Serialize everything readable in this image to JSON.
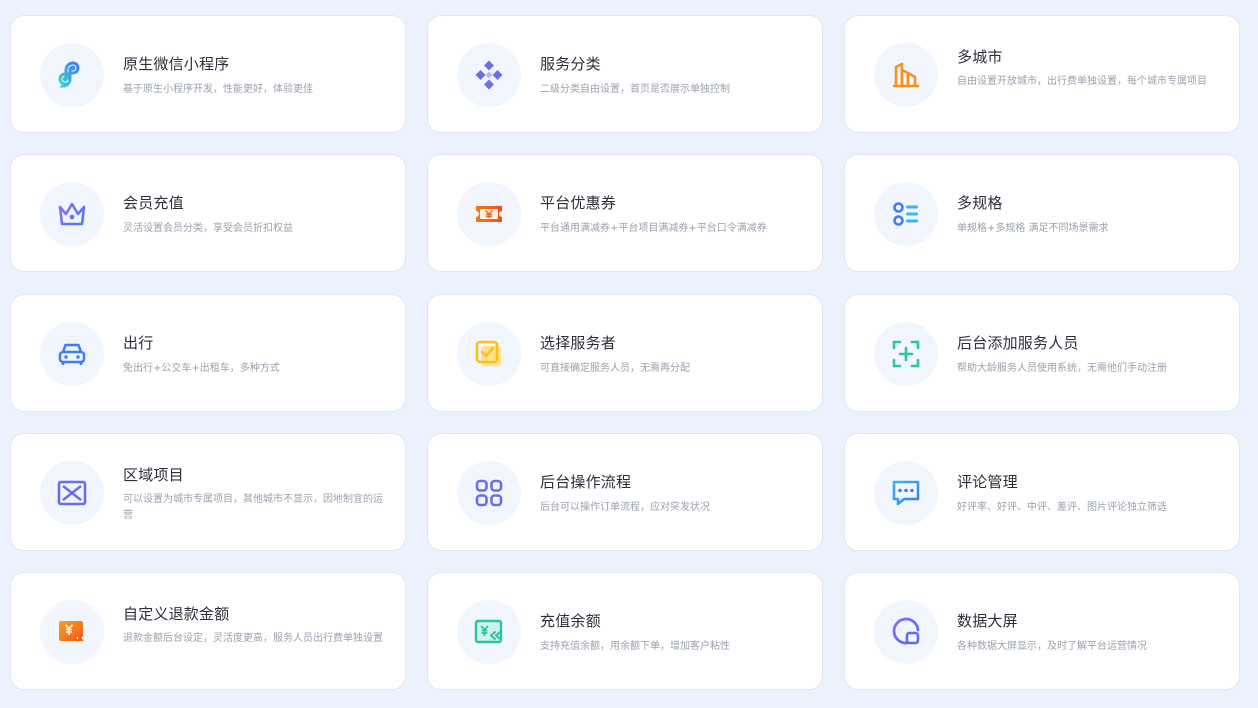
{
  "features": [
    {
      "title": "原生微信小程序",
      "desc": "基于原生小程序开发，性能更好，体验更佳",
      "icon": "link-icon"
    },
    {
      "title": "服务分类",
      "desc": "二级分类自由设置，首页是否展示单独控制",
      "icon": "category-diamond-icon"
    },
    {
      "title": "多城市",
      "desc": "自由设置开放城市，出行费单独设置，每个城市专属项目",
      "icon": "city-building-icon"
    },
    {
      "title": "会员充值",
      "desc": "灵活设置会员分类，享受会员折扣权益",
      "icon": "crown-icon"
    },
    {
      "title": "平台优惠券",
      "desc": "平台通用满减券+平台项目满减券+平台口令满减券",
      "icon": "coupon-icon"
    },
    {
      "title": "多规格",
      "desc": "单规格+多规格 满足不同场景需求",
      "icon": "spec-list-icon"
    },
    {
      "title": "出行",
      "desc": "免出行+公交车+出租车，多种方式",
      "icon": "car-icon"
    },
    {
      "title": "选择服务者",
      "desc": "可直接确定服务人员，无需再分配",
      "icon": "check-card-icon"
    },
    {
      "title": "后台添加服务人员",
      "desc": "帮助大龄服务人员使用系统，无需他们手动注册",
      "icon": "add-person-icon"
    },
    {
      "title": "区域项目",
      "desc": "可以设置为城市专属项目，其他城市不显示，因地制宜的运营",
      "icon": "region-map-icon"
    },
    {
      "title": "后台操作流程",
      "desc": "后台可以操作订单流程，应对突发状况",
      "icon": "grid-apps-icon"
    },
    {
      "title": "评论管理",
      "desc": "好评率、好评、中评、差评、图片评论独立筛选",
      "icon": "comment-icon"
    },
    {
      "title": "自定义退款金额",
      "desc": "退款金额后台设定，灵活度更高，服务人员出行费单独设置",
      "icon": "refund-icon"
    },
    {
      "title": "充值余额",
      "desc": "支持充值余额，用余额下单，增加客户粘性",
      "icon": "recharge-icon"
    },
    {
      "title": "数据大屏",
      "desc": "各种数据大屏显示，及时了解平台运营情况",
      "icon": "data-screen-icon"
    }
  ]
}
